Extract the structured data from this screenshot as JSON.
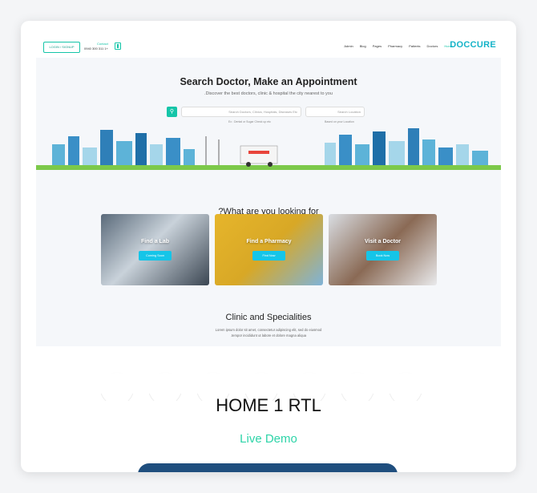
{
  "header": {
    "login_label": "LOGIN / SIGNUP",
    "contact_label": "Contact",
    "contact_phone": "0940 300 311 1+",
    "nav": [
      "Admin",
      "Blog",
      "Pages",
      "Pharmacy",
      "Patients",
      "Doctors",
      "Home"
    ],
    "active_nav": "Home",
    "logo": "DOCCURE"
  },
  "hero": {
    "title": "Search Doctor, Make an Appointment",
    "subtitle": ".Discover the best doctors, clinic & hospital the city nearest to you",
    "search_placeholder": "Search Doctors, Clinics, Hospitals, Diseases Etc",
    "location_placeholder": "Search Location",
    "search_hint": "Ex : Dental or Sugar Check up etc",
    "location_hint": "Based on your Location"
  },
  "looking": {
    "title": "?What are you looking for",
    "tiles": [
      {
        "title": "Find a Lab",
        "button": "Coming Soon"
      },
      {
        "title": "Find a Pharmacy",
        "button": "Find Now"
      },
      {
        "title": "Visit a Doctor",
        "button": "Book Now"
      }
    ]
  },
  "clinic": {
    "title": "Clinic and Specialities",
    "text1": "Lorem ipsum dolor sit amet, consectetur adipiscing elit, sed do eiusmod",
    "text2": ".tempor incididunt ut labore et dolore magna aliqua"
  },
  "demo": {
    "title": "HOME 1 RTL",
    "link": "Live Demo"
  },
  "colors": {
    "accent": "#15c5a8",
    "live_demo": "#2dd4a8",
    "bottom_bar": "#1f4e7e"
  }
}
